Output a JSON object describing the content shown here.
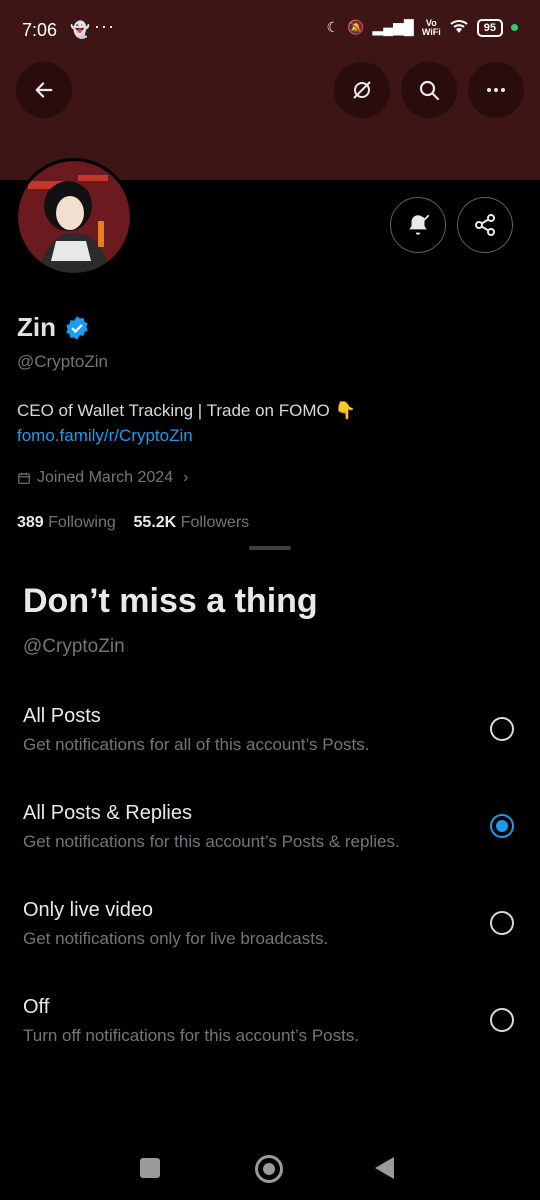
{
  "status_bar": {
    "time": "7:06",
    "dots": "···",
    "vowifi": "Vo\nWiFi",
    "battery": "95"
  },
  "profile": {
    "name": "Zin",
    "handle": "@CryptoZin",
    "bio": "CEO of Wallet Tracking | Trade on FOMO 👇",
    "link": "fomo.family/r/CryptoZin",
    "joined": "Joined March 2024",
    "following_count": "389",
    "following_label": "Following",
    "followers_count": "55.2K",
    "followers_label": "Followers"
  },
  "sheet": {
    "title": "Don’t miss a thing",
    "handle": "@CryptoZin",
    "options": [
      {
        "label": "All Posts",
        "desc": "Get notifications for all of this account’s Posts.",
        "selected": false
      },
      {
        "label": "All Posts & Replies",
        "desc": "Get notifications for this account’s Posts & replies.",
        "selected": true
      },
      {
        "label": "Only live video",
        "desc": "Get notifications only for live broadcasts.",
        "selected": false
      },
      {
        "label": "Off",
        "desc": "Turn off notifications for this account’s Posts.",
        "selected": false
      }
    ]
  },
  "colors": {
    "banner": "#3d1515",
    "accent": "#1d9bf0",
    "muted": "#71767b"
  }
}
